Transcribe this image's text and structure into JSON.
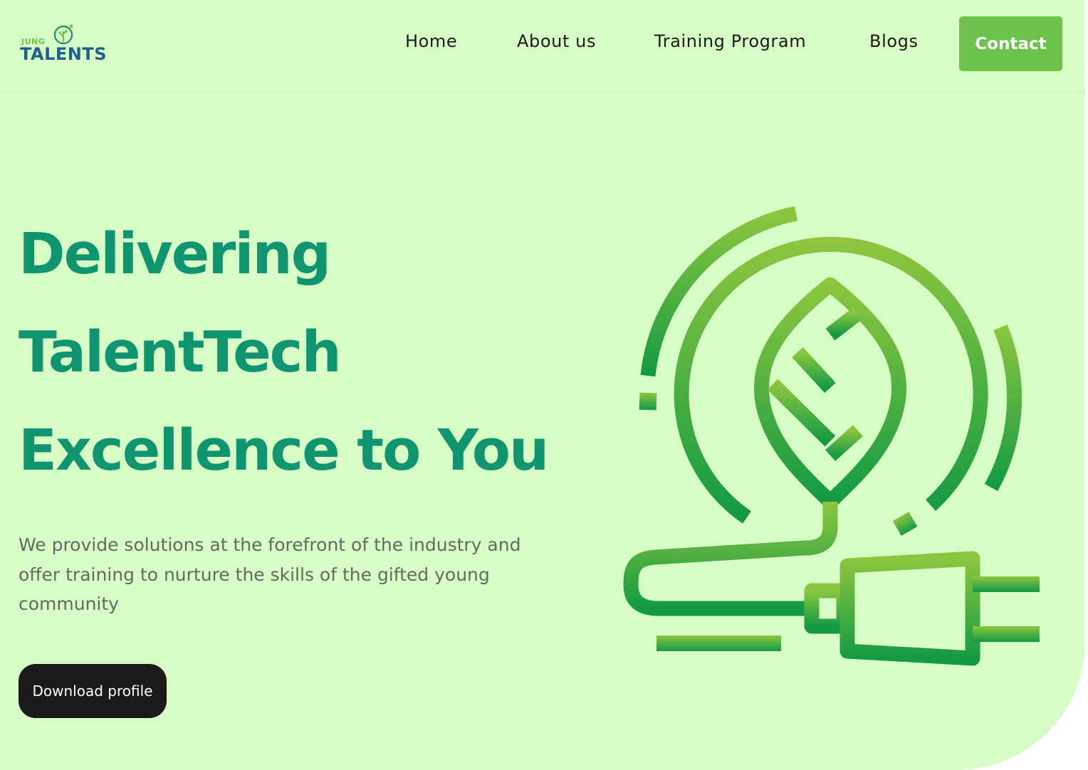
{
  "brand": {
    "logo_top": "JUNG",
    "logo_main": "TALENTS"
  },
  "nav": {
    "items": [
      {
        "label": "Home"
      },
      {
        "label": "About us"
      },
      {
        "label": "Training Program"
      },
      {
        "label": "Blogs"
      }
    ],
    "contact_label": "Contact"
  },
  "hero": {
    "headline_lines": [
      "Delivering",
      "TalentTech",
      "Excellence to You"
    ],
    "subtitle": "We provide solutions at the forefront of the industry and offer training to nurture the skills of the gifted young community",
    "download_label": "Download profile",
    "illustration_icon": "leaf-plug-icon"
  },
  "colors": {
    "background": "#d8fcc6",
    "headline": "#119570",
    "accent": "#6cc24a",
    "button_dark": "#1a1a1a",
    "body_text": "#5f6b64",
    "logo_blue": "#1f5f8b"
  }
}
